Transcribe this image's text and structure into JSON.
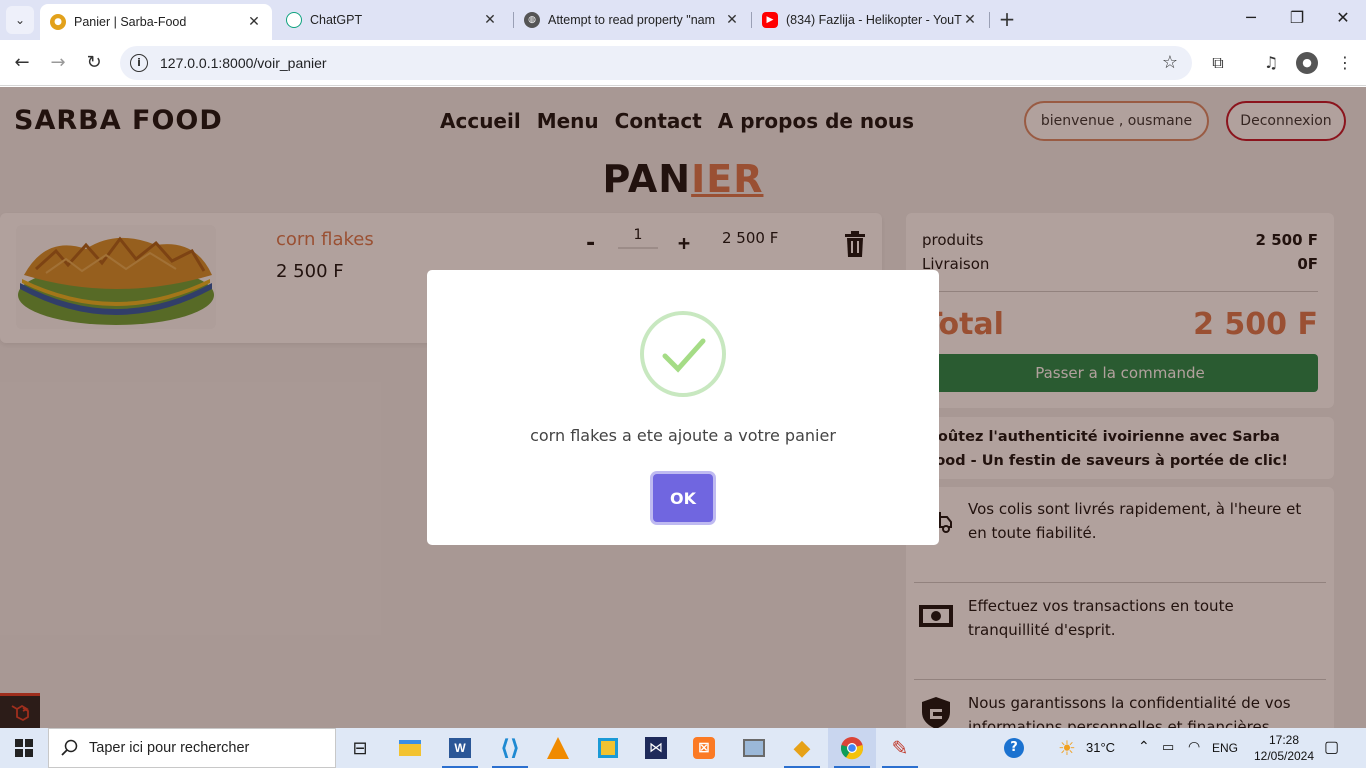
{
  "browser": {
    "tabs": [
      {
        "title": "Panier | Sarba-Food",
        "icon": "sarba-favicon",
        "active": true
      },
      {
        "title": "ChatGPT",
        "icon": "chatgpt-favicon",
        "active": false
      },
      {
        "title": "Attempt to read property \"nam",
        "icon": "globe-favicon",
        "active": false
      },
      {
        "title": "(834) Fazlija - Helikopter - YouT",
        "icon": "youtube-favicon",
        "active": false
      }
    ],
    "url": "127.0.0.1:8000/voir_panier"
  },
  "site": {
    "brand": "SARBA FOOD",
    "nav": [
      "Accueil",
      "Menu",
      "Contact",
      "A propos de nous"
    ],
    "welcome": "bienvenue , ousmane",
    "logout": "Deconnexion",
    "title_part1": "PAN",
    "title_part2": "IER"
  },
  "cart": {
    "item": {
      "name": "corn flakes",
      "price": "2 500 F",
      "qty_minus": "-",
      "quantity": "1",
      "qty_plus": "+",
      "line_total": "2 500 F"
    }
  },
  "summary": {
    "products_label": "produits",
    "products_value": "2 500 F",
    "delivery_label": "Livraison",
    "delivery_value": "0F",
    "total_label": "Total",
    "total_value": "2 500 F",
    "order_button": "Passer a la commande"
  },
  "promo": "Goûtez l'authenticité ivoirienne avec Sarba Food - Un festin de saveurs à portée de clic!",
  "features": [
    {
      "icon": "delivery-truck-icon",
      "text": "Vos colis sont livrés rapidement, à l'heure et en toute fiabilité."
    },
    {
      "icon": "cash-icon",
      "text": "Effectuez vos transactions en toute tranquillité d'esprit."
    },
    {
      "icon": "shield-icon",
      "text": "Nous garantissons la confidentialité de vos informations personnelles et financières."
    }
  ],
  "modal": {
    "message": "corn flakes a ete ajoute a votre panier",
    "ok": "OK"
  },
  "taskbar": {
    "search_placeholder": "Taper ici pour rechercher",
    "weather": "31°C",
    "language": "ENG",
    "time": "17:28",
    "date": "12/05/2024"
  },
  "colors": {
    "accent": "#d9794f",
    "order_button": "#1f8a4c",
    "ok_button": "#7066e0",
    "logout_border": "#c0152a"
  }
}
